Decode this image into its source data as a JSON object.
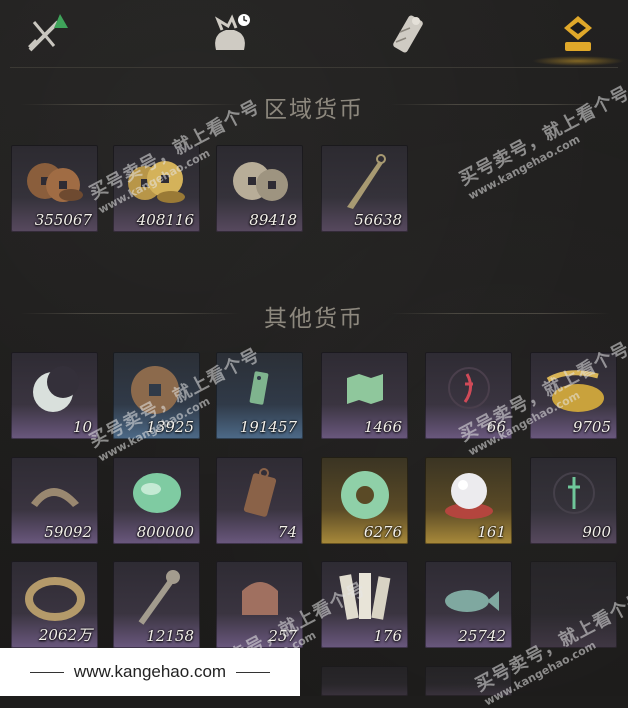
{
  "tabs": [
    {
      "name": "weapons-tab",
      "icon": "crossed-swords-icon"
    },
    {
      "name": "bag-tab",
      "icon": "bundle-bag-icon"
    },
    {
      "name": "scroll-tab",
      "icon": "scroll-icon"
    },
    {
      "name": "currency-tab",
      "icon": "currency-icon"
    }
  ],
  "sections": {
    "regional": {
      "title": "区域货币"
    },
    "other": {
      "title": "其他货币"
    }
  },
  "regional_items": [
    {
      "count": "355067",
      "icon": "bronze-coins-icon"
    },
    {
      "count": "408116",
      "icon": "gold-coins-icon"
    },
    {
      "count": "89418",
      "icon": "silver-coins-icon"
    },
    {
      "count": "56638",
      "icon": "dart-blade-icon"
    }
  ],
  "other_items": [
    {
      "count": "10",
      "icon": "jade-crescent-icon"
    },
    {
      "count": "13925",
      "icon": "ancient-coin-icon"
    },
    {
      "count": "191457",
      "icon": "jade-token-icon"
    },
    {
      "count": "1466",
      "icon": "map-icon"
    },
    {
      "count": "66",
      "icon": "red-sigil-icon"
    },
    {
      "count": "9705",
      "icon": "gold-grain-icon"
    },
    {
      "count": "59092",
      "icon": "knife-coin-icon"
    },
    {
      "count": "800000",
      "icon": "jade-stone-icon"
    },
    {
      "count": "74",
      "icon": "bronze-plaque-icon"
    },
    {
      "count": "6276",
      "icon": "jade-disc-icon"
    },
    {
      "count": "161",
      "icon": "pearl-icon"
    },
    {
      "count": "900",
      "icon": "green-sigil-icon"
    },
    {
      "count": "2062万",
      "icon": "coin-string-icon"
    },
    {
      "count": "12158",
      "icon": "coin-sword-icon"
    },
    {
      "count": "257",
      "icon": "seal-stone-icon"
    },
    {
      "count": "176",
      "icon": "paper-slips-icon"
    },
    {
      "count": "25742",
      "icon": "jade-fish-icon"
    }
  ],
  "watermark": {
    "text": "买号卖号，就上看个号",
    "url": "www.kangehao.com",
    "badge": "看个号"
  },
  "footer": {
    "url": "www.kangehao.com"
  }
}
